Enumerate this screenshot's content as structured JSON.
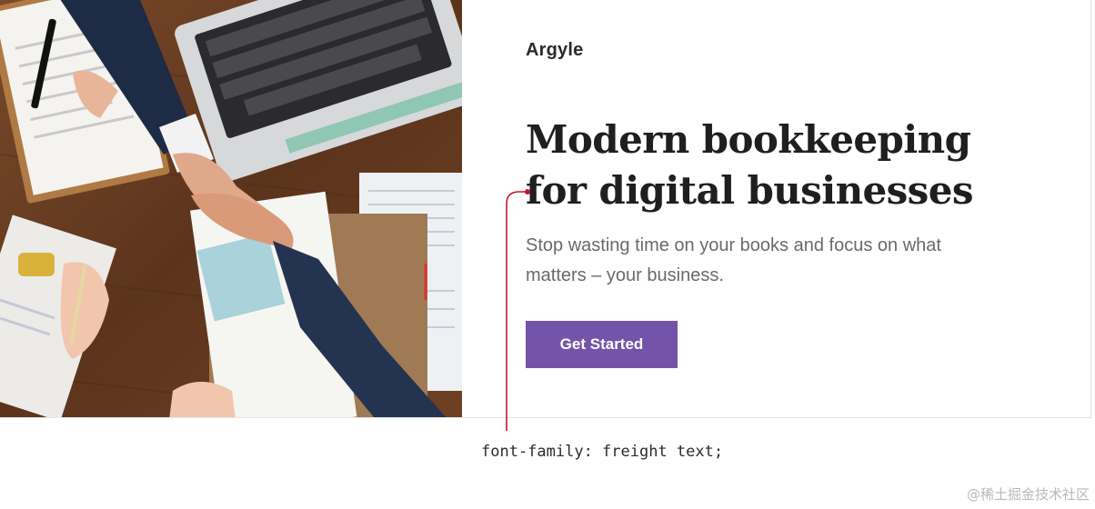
{
  "brand": {
    "name": "Argyle"
  },
  "hero": {
    "headline_line1": "Modern bookkeeping",
    "headline_line2": "for digital businesses",
    "subtext": "Stop wasting time on your books and focus on what matters – your business.",
    "cta_label": "Get Started",
    "photo_icon": "handshake-photo"
  },
  "annotation": {
    "code": "font-family: freight text;",
    "pointer_color": "#c8102e"
  },
  "watermark": {
    "text": "@稀土掘金技术社区"
  },
  "colors": {
    "accent": "#7454a8",
    "headline": "#1f1f1f",
    "subtext": "#6a6a6a"
  }
}
